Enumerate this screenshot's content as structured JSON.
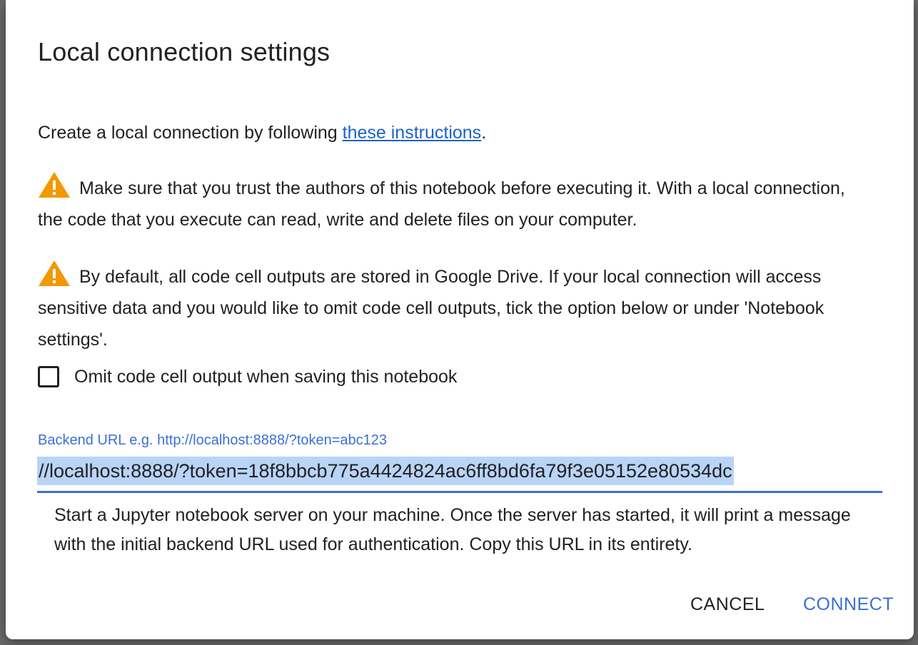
{
  "dialog": {
    "title": "Local connection settings",
    "intro_prefix": "Create a local connection by following ",
    "intro_link": "these instructions",
    "intro_suffix": ".",
    "warning1_icon": "warning-icon",
    "warning1": "Make sure that you trust the authors of this notebook before executing it. With a local connection, the code that you execute can read, write and delete files on your computer.",
    "warning2_icon": "warning-icon",
    "warning2": "By default, all code cell outputs are stored in Google Drive. If your local connection will access sensitive data and you would like to omit code cell outputs, tick the option below or under 'Notebook settings'.",
    "checkbox_label": "Omit code cell output when saving this notebook",
    "checkbox_checked": false,
    "url_field_label": "Backend URL e.g. http://localhost:8888/?token=abc123",
    "url_value": "//localhost:8888/?token=18f8bbcb775a4424824ac6ff8bd6fa79f3e05152e80534dc",
    "helper_text": "Start a Jupyter notebook server on your machine. Once the server has started, it will print a message with the initial backend URL used for authentication. Copy this URL in its entirety.",
    "cancel_label": "CANCEL",
    "connect_label": "CONNECT"
  },
  "colors": {
    "accent": "#3b6fd4",
    "link": "#1a62c9",
    "warning": "#f29900",
    "text": "#202124",
    "selection": "#b9d4f6"
  }
}
